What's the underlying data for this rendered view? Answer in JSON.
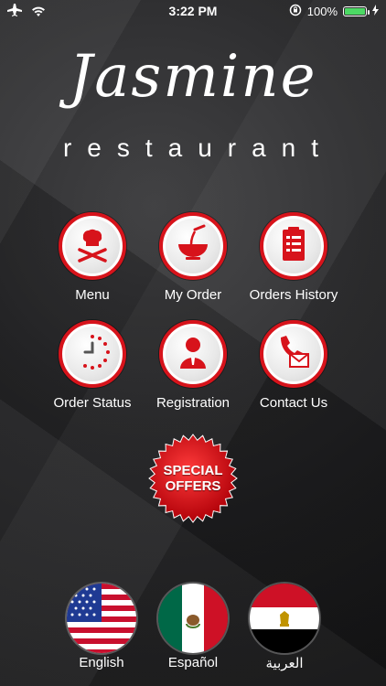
{
  "status_bar": {
    "time": "3:22 PM",
    "battery_text": "100%",
    "icons": [
      "airplane-icon",
      "wifi-icon",
      "rotation-lock-icon",
      "battery-icon",
      "charging-icon"
    ]
  },
  "logo": {
    "title": "Jasmine",
    "subtitle": "restaurant"
  },
  "menu_buttons": [
    {
      "label": "Menu",
      "icon": "chef-icon"
    },
    {
      "label": "My Order",
      "icon": "noodle-bowl-icon"
    },
    {
      "label": "Orders History",
      "icon": "clipboard-icon"
    },
    {
      "label": "Order Status",
      "icon": "clock-icon"
    },
    {
      "label": "Registration",
      "icon": "user-icon"
    },
    {
      "label": "Contact Us",
      "icon": "phone-mail-icon"
    }
  ],
  "special_offers": {
    "line1": "SPECIAL",
    "line2": "OFFERS",
    "color": "#e0141c"
  },
  "languages": [
    {
      "label": "English",
      "flag": "us-flag-icon"
    },
    {
      "label": "Español",
      "flag": "mexico-flag-icon"
    },
    {
      "label": "العربية",
      "flag": "egypt-flag-icon"
    }
  ],
  "colors": {
    "accent": "#d7131b",
    "battery": "#4cd964"
  }
}
